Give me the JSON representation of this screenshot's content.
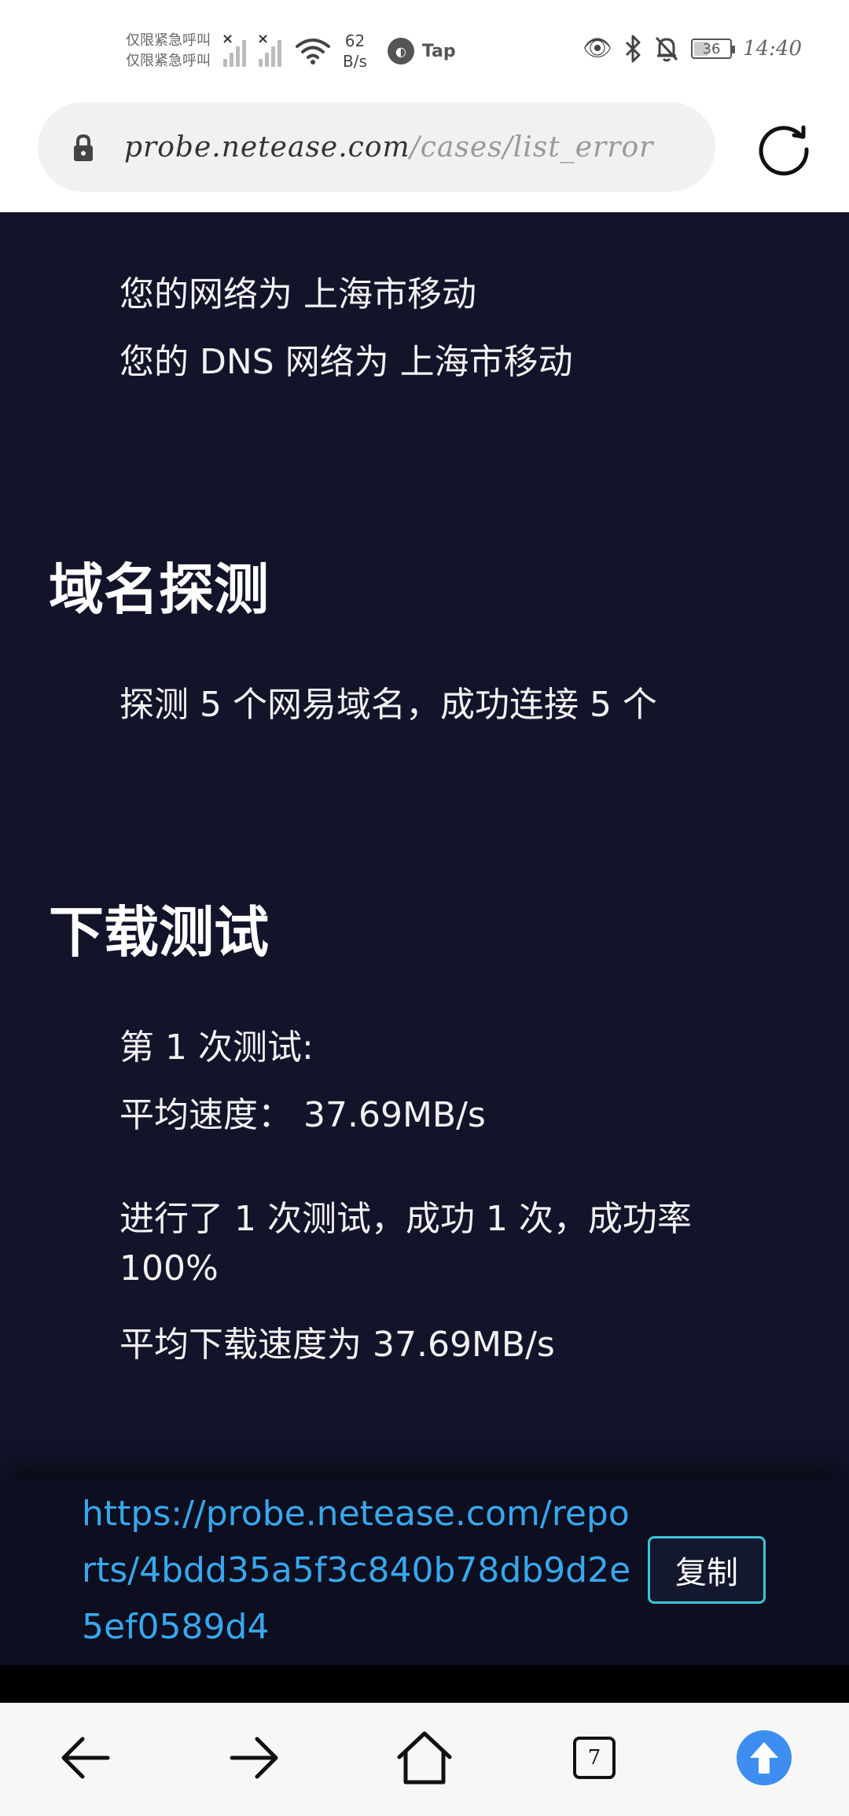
{
  "status_bar": {
    "carrier_line1": "仅限紧急呼叫",
    "carrier_line2": "仅限紧急呼叫",
    "speed_value": "62",
    "speed_unit": "B/s",
    "tap_label": "Tap",
    "battery_level": "36",
    "time": "14:40"
  },
  "address_bar": {
    "url_host": "probe.netease.com",
    "url_path": "/cases/list_error"
  },
  "content": {
    "network_line": "您的网络为 上海市移动",
    "dns_line": "您的 DNS 网络为 上海市移动",
    "domain_heading": "域名探测",
    "domain_result": "探测 5 个网易域名，成功连接 5 个",
    "download_heading": "下载测试",
    "test1_label": "第 1 次测试:",
    "avg_speed_line": "平均速度：  37.69MB/s",
    "summary_line1": "进行了 1 次测试，成功 1 次，成功率",
    "summary_line2": "100%",
    "avg_download_line": "平均下载速度为 37.69MB/s"
  },
  "report": {
    "url": "https://probe.netease.com/reports/4bdd35a5f3c840b78db9d2e5ef0589d4",
    "copy_label": "复制"
  },
  "bottom_nav": {
    "tabs_count": "7"
  },
  "colors": {
    "content_bg": "#13142a",
    "report_bg": "#0d0e20",
    "link": "#37a8ec",
    "copy_border": "#3cc4d8",
    "upload_button": "#3d8ef0"
  }
}
